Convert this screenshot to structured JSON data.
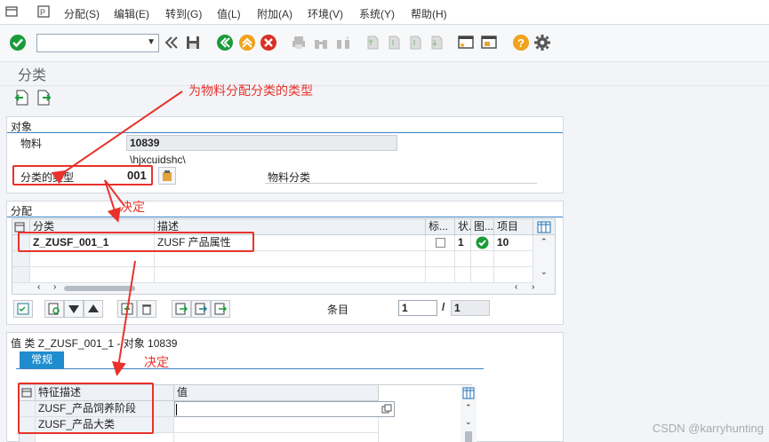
{
  "menu": {
    "items": [
      "分配(S)",
      "编辑(E)",
      "转到(G)",
      "值(L)",
      "附加(A)",
      "环境(V)",
      "系统(Y)",
      "帮助(H)"
    ]
  },
  "toolbar": {
    "command_value": ""
  },
  "title": "分类",
  "object_panel": {
    "header": "对象",
    "material_label": "物料",
    "material_value": "10839",
    "material_desc": "\\hjxcuidshc\\",
    "class_type_label": "分类的类型",
    "class_type_value": "001",
    "class_type_desc": "物料分类"
  },
  "assign_panel": {
    "header": "分配",
    "columns": [
      "分类",
      "描述",
      "标...",
      "状.",
      "图...",
      "项目"
    ],
    "rows": [
      {
        "class": "Z_ZUSF_001_1",
        "desc": "ZUSF 产品属性",
        "std": "",
        "status": "1",
        "item": "10"
      }
    ],
    "entry_label": "条目",
    "entry_current": "1",
    "entry_sep": "/",
    "entry_total": "1"
  },
  "values_panel": {
    "header": "值 类 Z_ZUSF_001_1 - 对象 10839",
    "tab": "常规",
    "columns": [
      "特征描述",
      "值"
    ],
    "rows": [
      {
        "char": "ZUSF_产品饲养阶段",
        "value": ""
      },
      {
        "char": "ZUSF_产品大类",
        "value": ""
      }
    ]
  },
  "annotations": {
    "a1": "为物料分配分类的类型",
    "a2": "决定",
    "a3": "决定"
  },
  "watermark": "CSDN @karryhunting",
  "colors": {
    "accent_blue": "#1f8ccf",
    "annotation_red": "#e8322b",
    "ok_green": "#1a9b3a"
  }
}
